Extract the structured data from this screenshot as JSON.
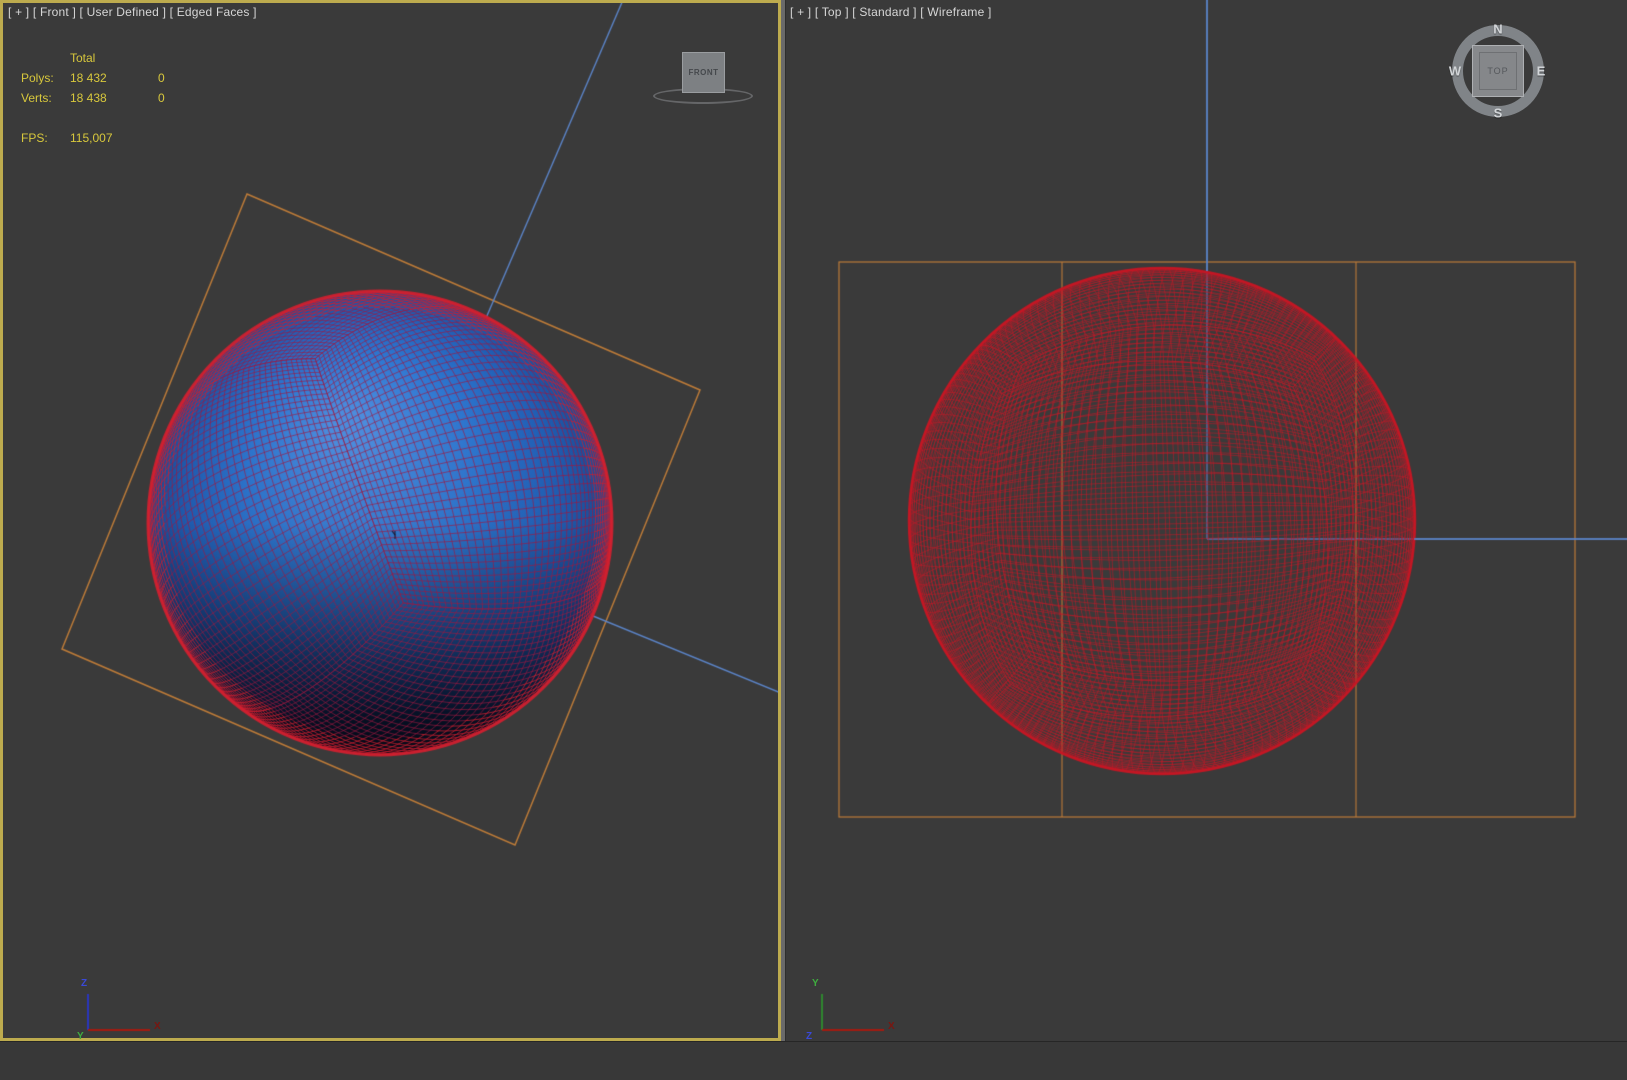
{
  "viewports": {
    "left": {
      "label": "[ + ] [ Front ] [ User Defined ] [ Edged Faces ]",
      "stats": {
        "total_header": "Total",
        "polys_label": "Polys:",
        "polys_total": "18 432",
        "polys_selected": "0",
        "verts_label": "Verts:",
        "verts_total": "18 438",
        "verts_selected": "0",
        "fps_label": "FPS:",
        "fps_value": "115,007"
      },
      "view_cube": {
        "face_label": "FRONT"
      },
      "axis_tripod": {
        "up_label": "Z",
        "right_label": "X",
        "origin_label": "Y"
      }
    },
    "right": {
      "label": "[ + ] [ Top ] [ Standard ] [ Wireframe ]",
      "view_cube": {
        "face_label": "TOP",
        "north": "N",
        "south": "S",
        "east": "E",
        "west": "W"
      },
      "axis_tripod": {
        "up_label": "Y",
        "right_label": "X",
        "origin_label": "Z"
      }
    }
  },
  "colors": {
    "background": "#3a3a3a",
    "active_border": "#bdab4e",
    "splitter": "#6a6a6a",
    "label_text": "#d6d6d6",
    "stats_text": "#d8c83c",
    "helper_orange": "#bd7b38",
    "axis_line_blue": "#5b84c8",
    "wire_red": "#c22130",
    "sphere_blue": "#2f7ad6",
    "tripod_x_red": "#a41b10",
    "tripod_y_green": "#3fae3f",
    "tripod_z_blue": "#3a49d8"
  }
}
